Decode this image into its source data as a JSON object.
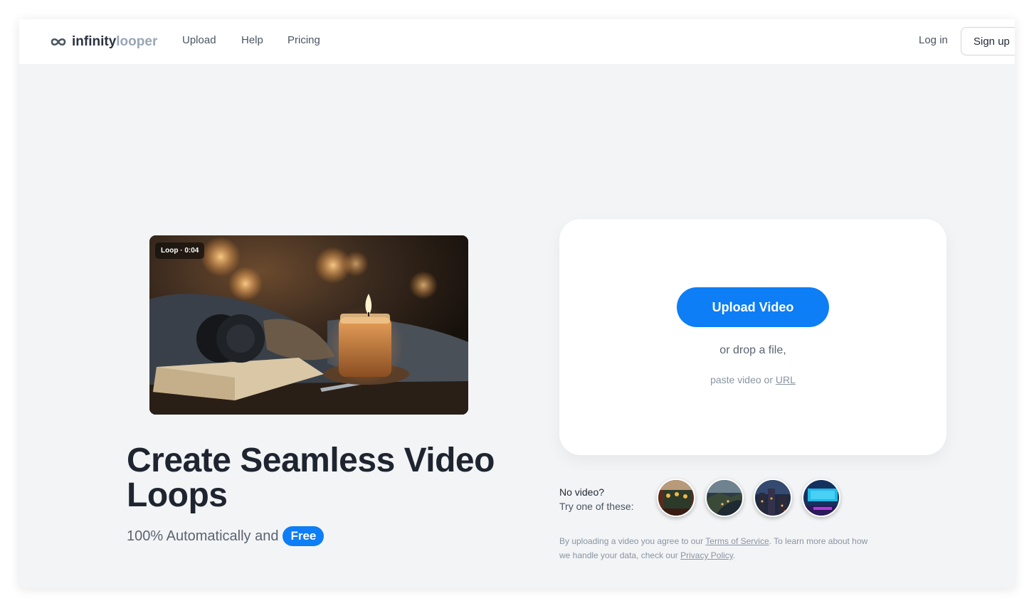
{
  "header": {
    "logo": {
      "part1": "infinity",
      "part2": "looper",
      "icon": "infinity-icon"
    },
    "nav": {
      "upload": "Upload",
      "help": "Help",
      "pricing": "Pricing"
    },
    "login": "Log in",
    "signup": "Sign up"
  },
  "hero": {
    "video_badge": "Loop · 0:04",
    "title": "Create Seamless Video Loops",
    "subtitle": "100% Automatically and",
    "free_badge": "Free"
  },
  "upload": {
    "button": "Upload Video",
    "drop_text": "or drop a file,",
    "paste_prefix": "paste video or",
    "url_link": "URL"
  },
  "samples": {
    "no_video": "No video?",
    "try_text": "Try one of these:",
    "items": [
      {
        "icon": "market-stall-thumbnail"
      },
      {
        "icon": "river-city-thumbnail"
      },
      {
        "icon": "night-city-thumbnail"
      },
      {
        "icon": "neon-room-thumbnail"
      }
    ]
  },
  "legal": {
    "part1": "By uploading a video you agree to our",
    "tos_link": "Terms of Service",
    "part2": ". To learn more about how we handle your data, check our",
    "privacy_link": "Privacy Policy",
    "part3": "."
  },
  "colors": {
    "accent": "#0d7ef5",
    "background": "#f3f4f6",
    "heading": "#1f2530"
  }
}
